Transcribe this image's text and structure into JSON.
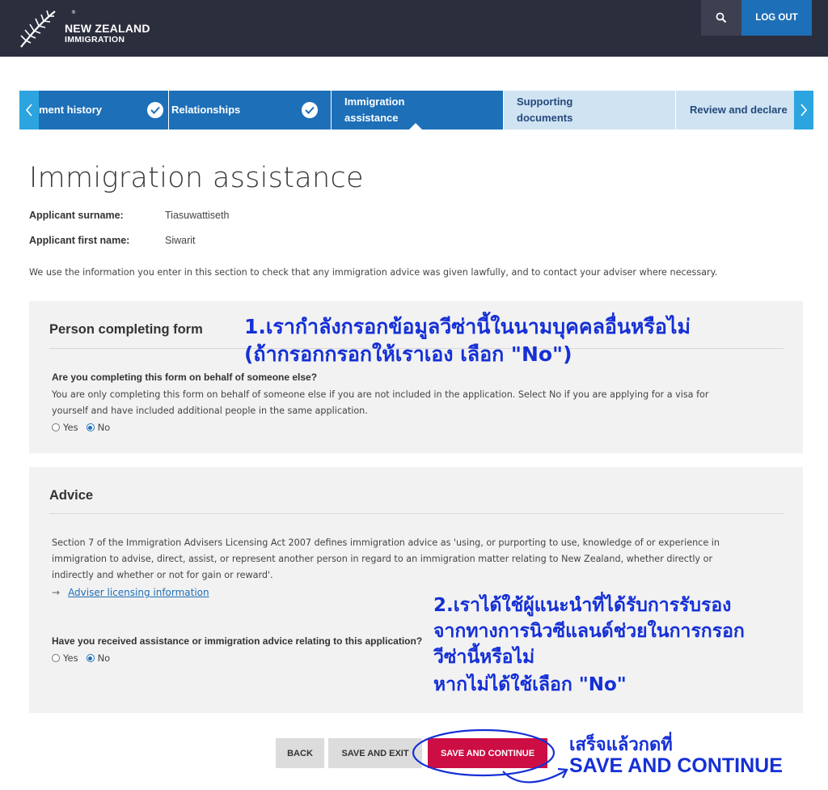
{
  "header": {
    "logo_line1": "NEW ZEALAND",
    "logo_line2": "IMMIGRATION",
    "logout_label": "LOG OUT"
  },
  "steps": {
    "items": [
      {
        "label": "ment history",
        "status": "done"
      },
      {
        "label": "Relationships",
        "status": "done"
      },
      {
        "label_line1": "Immigration",
        "label_line2": "assistance",
        "status": "current"
      },
      {
        "label_line1": "Supporting",
        "label_line2": "documents",
        "status": "todo"
      },
      {
        "label": "Review and declare",
        "status": "todo"
      }
    ]
  },
  "page": {
    "title": "Immigration assistance",
    "surname_label": "Applicant surname:",
    "surname_value": "Tiasuwattiseth",
    "firstname_label": "Applicant first name:",
    "firstname_value": "Siwarit",
    "intro": "We use the information you enter in this section to check that any immigration advice was given lawfully, and to contact your adviser where necessary."
  },
  "person_panel": {
    "title": "Person completing form",
    "question": "Are you completing this form on behalf of someone else?",
    "help_line1": "You are only completing this form on behalf of someone else if you are not included in the application. Select No if you are applying for a visa for",
    "help_line2": "yourself and have included additional people in the same application.",
    "yes_label": "Yes",
    "no_label": "No",
    "selected": "No"
  },
  "advice_panel": {
    "title": "Advice",
    "body_line1": "Section 7 of the Immigration Advisers Licensing Act 2007 defines immigration advice as 'using, or purporting to use, knowledge of or experience in",
    "body_line2": "immigration to advise, direct, assist, or represent another person in regard to an immigration matter relating to New Zealand, whether directly or",
    "body_line3": "indirectly and whether or not for gain or reward'.",
    "link_arrow": "→",
    "link_label": "Adviser licensing information",
    "question": "Have you received assistance or immigration advice relating to this application?",
    "yes_label": "Yes",
    "no_label": "No",
    "selected": "No"
  },
  "buttons": {
    "back": "BACK",
    "save_exit": "SAVE AND EXIT",
    "save_continue": "SAVE AND CONTINUE"
  },
  "annotations": {
    "note1_line1": "1.เรากำลังกรอกข้อมูลวีซ่านี้ในนามบุคคลอื่นหรือไม่",
    "note1_line2": "(ถ้ากรอกกรอกให้เราเอง เลือก \"No\")",
    "note2_line1": "2.เราได้ใช้ผู้แนะนำที่ได้รับการรับรอง",
    "note2_line2": "จากทางการนิวซีแลนด์ช่วยในการกรอก",
    "note2_line3": "วีซ่านี้หรือไม่",
    "note2_line4": "หากไม่ได้ใช้เลือก \"No\"",
    "note3_line1": "เสร็จแล้วกดที่",
    "note3_line2": "SAVE AND CONTINUE",
    "color": "#1530d6"
  },
  "colors": {
    "header_bg": "#2b2e3d",
    "brand_blue": "#1d6fb8",
    "step_todo_bg": "#cfe3f3",
    "nav_arrow": "#2ca4e0",
    "primary_button": "#cc0e44",
    "panel_bg": "#f2f2f2"
  }
}
